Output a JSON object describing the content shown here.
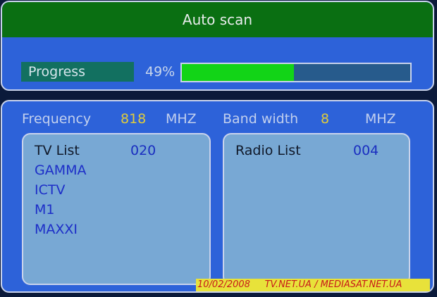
{
  "header": {
    "title": "Auto scan"
  },
  "progress": {
    "label": "Progress",
    "percent_text": "49%",
    "fraction": 0.49
  },
  "frequency": {
    "label": "Frequency",
    "value": "818",
    "unit": "MHZ"
  },
  "bandwidth": {
    "label": "Band width",
    "value": "8",
    "unit": "MHZ"
  },
  "tv_list": {
    "title": "TV List",
    "count": "020",
    "channels": [
      "GAMMA",
      "ICTV",
      "M1",
      "MAXXI"
    ]
  },
  "radio_list": {
    "title": "Radio List",
    "count": "004"
  },
  "watermark": {
    "text": "10/02/2008     TV.NET.UA / MEDIASAT.NET.UA"
  },
  "colors": {
    "title_bar": "#0a6f12",
    "panel": "#2d62d9",
    "progress_fill": "#12d417",
    "list_box": "#78a8d4",
    "value_yellow": "#e0cc3c"
  }
}
